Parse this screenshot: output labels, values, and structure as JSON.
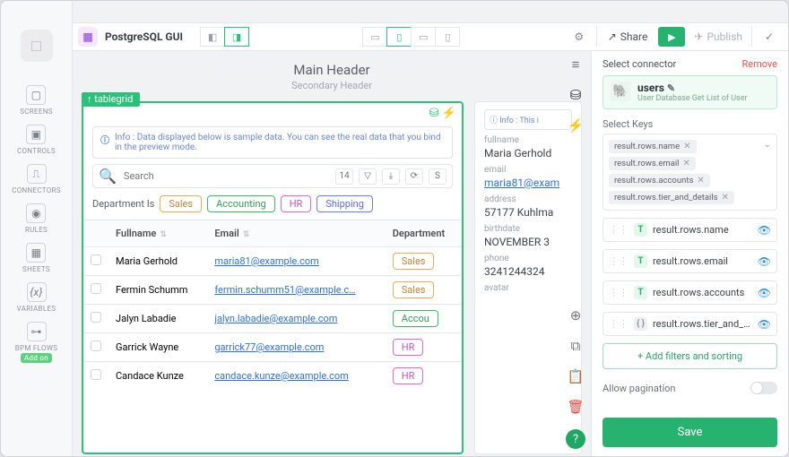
{
  "app": {
    "title": "PostgreSQL GUI"
  },
  "rail": {
    "items": [
      {
        "label": "SCREENS"
      },
      {
        "label": "CONTROLS"
      },
      {
        "label": "CONNECTORS"
      },
      {
        "label": "RULES"
      },
      {
        "label": "SHEETS"
      },
      {
        "label": "VARIABLES"
      },
      {
        "label": "BPM FLOWS",
        "addon": "Add on"
      }
    ]
  },
  "topbar": {
    "share": "Share",
    "publish": "Publish"
  },
  "headers": {
    "main": "Main Header",
    "secondary": "Secondary Header"
  },
  "tablegrid": {
    "handle": "↑ tablegrid",
    "info": "Info : Data displayed below is sample data. You can see the real data that you bind in the preview mode.",
    "search_placeholder": "Search",
    "page_count": "14",
    "sort_abbrev": "S",
    "filter_label": "Department Is",
    "filter_chips": [
      "Sales",
      "Accounting",
      "HR",
      "Shipping"
    ],
    "columns": [
      "Fullname",
      "Email",
      "Department"
    ],
    "rows": [
      {
        "fullname": "Maria Gerhold",
        "email": "maria81@example.com",
        "dept": "Sales"
      },
      {
        "fullname": "Fermin Schumm",
        "email": "fermin.schumm51@example.c…",
        "dept": "Sales"
      },
      {
        "fullname": "Jalyn Labadie",
        "email": "jalyn.labadie@example.com",
        "dept": "Accounting"
      },
      {
        "fullname": "Garrick Wayne",
        "email": "garrick77@example.com",
        "dept": "HR"
      },
      {
        "fullname": "Candace Kunze",
        "email": "candace.kunze@example.com",
        "dept": "HR"
      }
    ]
  },
  "detail": {
    "info": "Info : This i",
    "fields": {
      "fullname_label": "fullname",
      "fullname": "Maria Gerhold",
      "email_label": "email",
      "email": "maria81@exam",
      "address_label": "address",
      "address": "57177 Kuhlma",
      "birthdate_label": "birthdate",
      "birthdate": "NOVEMBER 3",
      "phone_label": "phone",
      "phone": "3241244324",
      "avatar_label": "avatar"
    }
  },
  "panel": {
    "select_connector": "Select connector",
    "remove": "Remove",
    "connector": {
      "name": "users",
      "sub": "User Database Get List of User"
    },
    "select_keys": "Select Keys",
    "keys": [
      "result.rows.name",
      "result.rows.email",
      "result.rows.accounts",
      "result.rows.tier_and_details"
    ],
    "mappings": [
      {
        "type": "T",
        "label": "result.rows.name"
      },
      {
        "type": "T",
        "label": "result.rows.email"
      },
      {
        "type": "T",
        "label": "result.rows.accounts"
      },
      {
        "type": "{}",
        "label": "result.rows.tier_and_detai…"
      }
    ],
    "add_filters": "+ Add filters and sorting",
    "allow_pagination": "Allow pagination",
    "save": "Save"
  }
}
